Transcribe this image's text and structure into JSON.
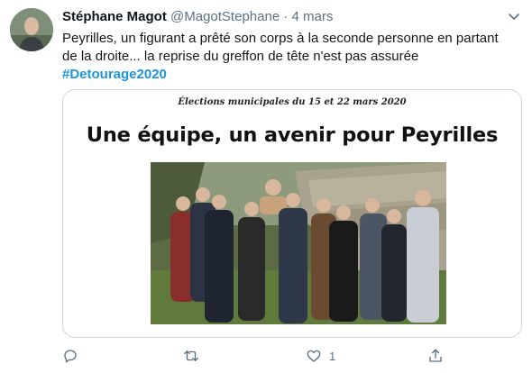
{
  "tweet": {
    "author_name": "Stéphane Magot",
    "handle": "@MagotStephane",
    "separator": "·",
    "time": "4 mars",
    "text": "Peyrilles, un figurant a prêté son corps à la seconde personne en partant de la droite... la reprise du greffon de tête n'est pas assurée",
    "hashtag": "#Detourage2020"
  },
  "card": {
    "subtitle": "Élections municipales du 15 et 22 mars 2020",
    "title": "Une équipe, un avenir pour Peyrilles"
  },
  "actions": {
    "reply_icon": "reply-icon",
    "retweet_icon": "retweet-icon",
    "like_icon": "heart-icon",
    "like_count": "1",
    "share_icon": "share-icon"
  },
  "colors": {
    "accent": "#1b95e0",
    "secondary_text": "#5b7083",
    "border": "#ccd6dd"
  }
}
